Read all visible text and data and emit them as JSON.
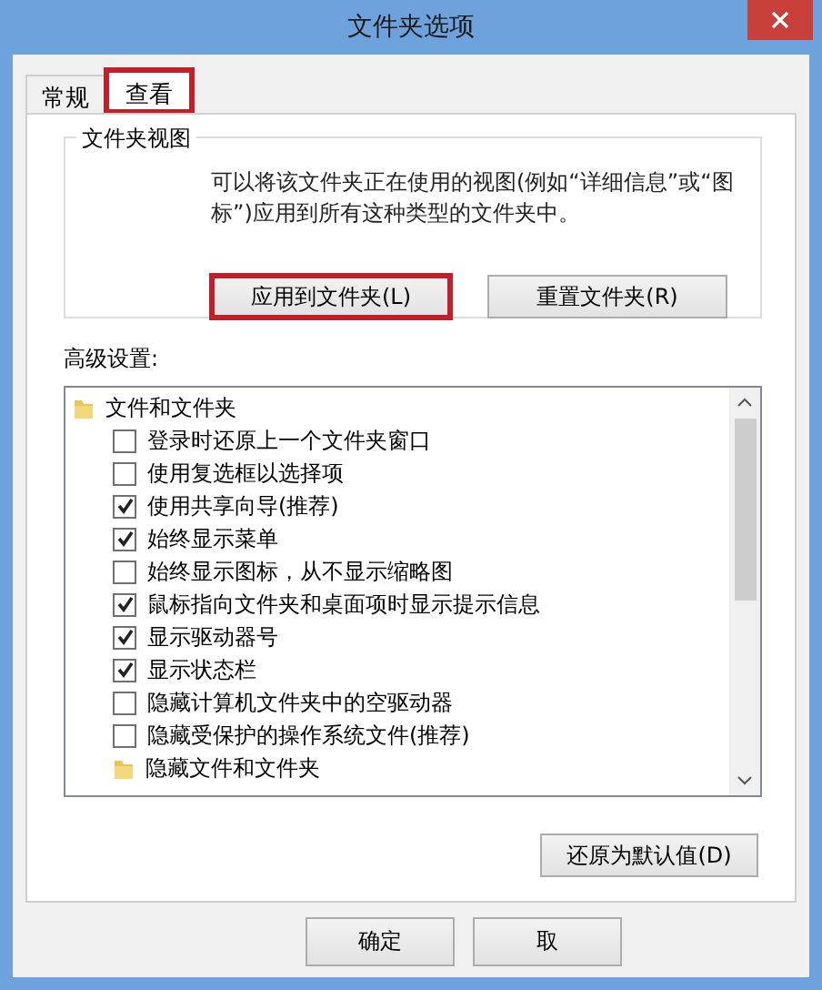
{
  "window": {
    "title": "文件夹选项"
  },
  "tabs": [
    {
      "label": "常规",
      "selected": false,
      "highlighted": false
    },
    {
      "label": "查看",
      "selected": true,
      "highlighted": true
    }
  ],
  "folder_views": {
    "title": "文件夹视图",
    "description": "可以将该文件夹正在使用的视图(例如“详细信息”或“图标”)应用到所有这种类型的文件夹中。",
    "buttons": [
      {
        "label": "应用到文件夹(L)",
        "highlighted": true
      },
      {
        "label": "重置文件夹(R)",
        "highlighted": false
      }
    ]
  },
  "advanced": {
    "label": "高级设置:",
    "items": [
      {
        "kind": "folder",
        "label": "文件和文件夹",
        "children": [
          {
            "kind": "checkbox",
            "label": "登录时还原上一个文件夹窗口",
            "checked": false
          },
          {
            "kind": "checkbox",
            "label": "使用复选框以选择项",
            "checked": false
          },
          {
            "kind": "checkbox",
            "label": "使用共享向导(推荐)",
            "checked": true
          },
          {
            "kind": "checkbox",
            "label": "始终显示菜单",
            "checked": true
          },
          {
            "kind": "checkbox",
            "label": "始终显示图标，从不显示缩略图",
            "checked": false
          },
          {
            "kind": "checkbox",
            "label": "鼠标指向文件夹和桌面项时显示提示信息",
            "checked": true
          },
          {
            "kind": "checkbox",
            "label": "显示驱动器号",
            "checked": true
          },
          {
            "kind": "checkbox",
            "label": "显示状态栏",
            "checked": true
          },
          {
            "kind": "checkbox",
            "label": "隐藏计算机文件夹中的空驱动器",
            "checked": false
          },
          {
            "kind": "checkbox",
            "label": "隐藏受保护的操作系统文件(推荐)",
            "checked": false
          },
          {
            "kind": "folder",
            "label": "隐藏文件和文件夹"
          }
        ]
      }
    ]
  },
  "restore_button": "还原为默认值(D)",
  "buttons": [
    "确定",
    "取"
  ]
}
